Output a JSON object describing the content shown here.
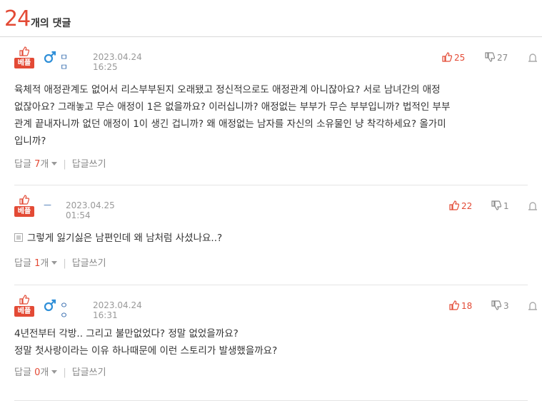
{
  "header": {
    "count": "24",
    "label": "개의 댓글"
  },
  "comments": [
    {
      "badge": "베플",
      "gender": "male",
      "nick": "ㅁㅁ",
      "date": "2023.04.24 16:25",
      "up": "25",
      "down": "27",
      "body_lines": [
        "육체적 애정관계도 없어서 리스부부된지 오래됐고 정신적으로도 애정관계 아니잖아요? 서로 남녀간의 애정",
        "없잖아요? 그래놓고 무슨 애정이 1은 없을까요? 이러십니까? 애정없는 부부가 무슨 부부입니까? 법적인 부부",
        "관계 끝내자니까 없던 애정이 1이 생긴 겁니까? 왜 애정없는 남자를 자신의 소유물인 냥 착각하세요? 올가미",
        "입니까?"
      ],
      "reply_label": "답글",
      "reply_count": "7",
      "reply_unit": "개",
      "write_label": "답글쓰기"
    },
    {
      "badge": "베플",
      "gender": "",
      "nick": "ㅡ",
      "date": "2023.04.25 01:54",
      "up": "22",
      "down": "1",
      "body_lines": [
        "그렇게 잃기싫은 남편인데 왜 남처럼 사셨나요..?"
      ],
      "reply_label": "답글",
      "reply_count": "1",
      "reply_unit": "개",
      "write_label": "답글쓰기"
    },
    {
      "badge": "베플",
      "gender": "male",
      "nick": "ㅇㅇ",
      "date": "2023.04.24 16:31",
      "up": "18",
      "down": "3",
      "body_lines": [
        "4년전부터 각방.. 그리고 불만없었다? 정말 없었을까요?",
        "정말 첫사랑이라는 이유 하나때문에 이런 스토리가 발생했을까요?"
      ],
      "reply_label": "답글",
      "reply_count": "0",
      "reply_unit": "개",
      "write_label": "답글쓰기"
    }
  ]
}
